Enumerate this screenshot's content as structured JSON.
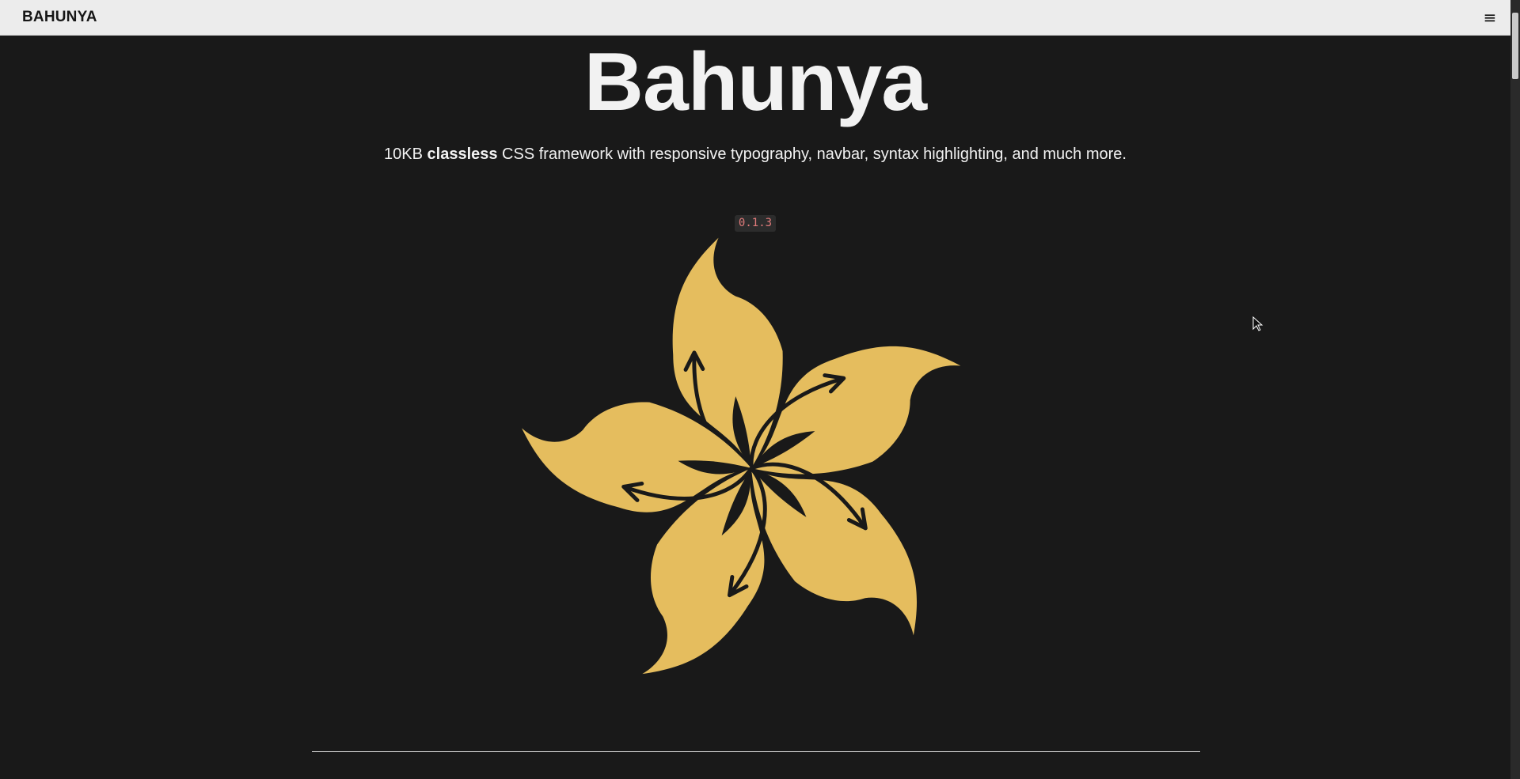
{
  "navbar": {
    "brand": "BAHUNYA",
    "menu_icon": "hamburger-menu-icon",
    "menu_glyph": "≡"
  },
  "hero": {
    "title": "Bahunya",
    "tagline_prefix": "10KB ",
    "tagline_bold": "classless",
    "tagline_suffix": " CSS framework with responsive typography, navbar, syntax highlighting, and much more.",
    "version": "0.1.3",
    "logo_icon": "bauhinia-flower-icon"
  },
  "colors": {
    "background": "#191919",
    "navbar": "#ececec",
    "flower": "#e5bd5e",
    "version_text": "#e07a7a"
  }
}
